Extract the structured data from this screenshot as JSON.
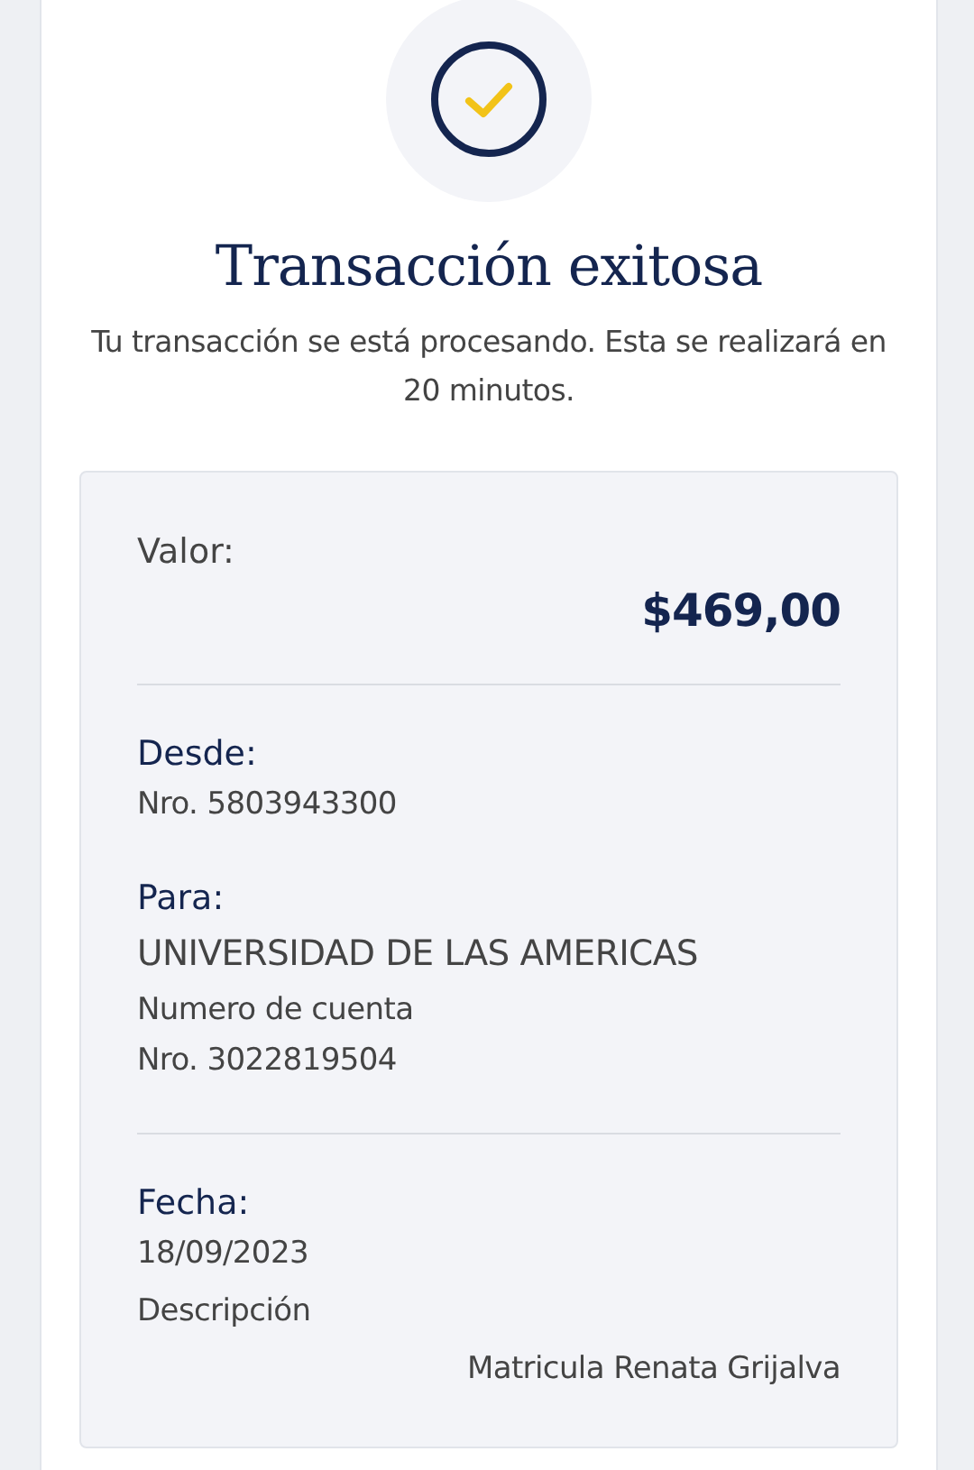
{
  "title": "Transacción exitosa",
  "message": "Tu transacción se está procesando. Esta se realizará en 20 minutos.",
  "details": {
    "amount_label": "Valor:",
    "amount": "$469,00",
    "from": {
      "label": "Desde:",
      "account": "Nro. 5803943300"
    },
    "to": {
      "label": "Para:",
      "name": "UNIVERSIDAD DE LAS AMERICAS",
      "account_label": "Numero de cuenta",
      "account": "Nro. 3022819504"
    },
    "date": {
      "label": "Fecha:",
      "value": "18/09/2023",
      "description_label": "Descripción",
      "description": "Matricula Renata Grijalva"
    }
  }
}
